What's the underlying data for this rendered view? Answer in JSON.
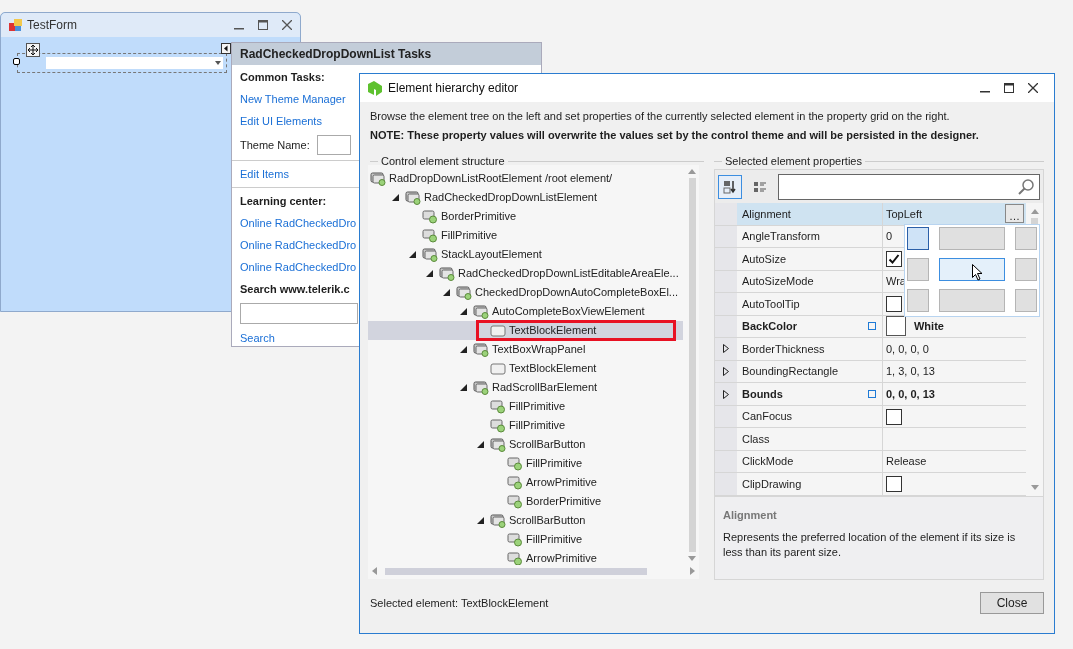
{
  "form": {
    "title": "TestForm"
  },
  "tasks": {
    "title": "RadCheckedDropDownList Tasks",
    "items": [
      {
        "kind": "heading",
        "text": "Common Tasks:"
      },
      {
        "kind": "link",
        "text": "New Theme Manager"
      },
      {
        "kind": "link",
        "text": "Edit UI Elements"
      },
      {
        "kind": "field",
        "text": "Theme Name:"
      },
      {
        "kind": "divider"
      },
      {
        "kind": "link",
        "text": "Edit Items"
      },
      {
        "kind": "divider"
      },
      {
        "kind": "heading",
        "text": "Learning center:"
      },
      {
        "kind": "link",
        "text": "Online RadCheckedDro"
      },
      {
        "kind": "link",
        "text": "Online RadCheckedDro"
      },
      {
        "kind": "link",
        "text": "Online RadCheckedDro"
      },
      {
        "kind": "heading",
        "text": "Search www.telerik.c"
      },
      {
        "kind": "input"
      },
      {
        "kind": "link",
        "text": "Search"
      }
    ]
  },
  "editor": {
    "title": "Element hierarchy editor",
    "description": "Browse the element tree on the left and set properties of the currently selected element in the property grid on the right.",
    "note": "NOTE: These property values will overwrite the values set by the control theme and will be persisted in the designer.",
    "tree": {
      "label": "Control element structure",
      "nodes": [
        {
          "text": "RadDropDownListRootElement /root element/",
          "kind": "element",
          "selected": false,
          "highlighted": false,
          "children": [
            {
              "text": "RadCheckedDropDownListElement",
              "kind": "element",
              "selected": false,
              "highlighted": false,
              "expanded": true,
              "children": [
                {
                  "text": "BorderPrimitive",
                  "kind": "primitive",
                  "selected": false,
                  "highlighted": false
                },
                {
                  "text": "FillPrimitive",
                  "kind": "primitive",
                  "selected": false,
                  "highlighted": false
                },
                {
                  "text": "StackLayoutElement",
                  "kind": "element",
                  "selected": false,
                  "highlighted": false,
                  "expanded": true,
                  "children": [
                    {
                      "text": "RadCheckedDropDownListEditableAreaEle...",
                      "kind": "element",
                      "selected": false,
                      "highlighted": false,
                      "expanded": true,
                      "children": [
                        {
                          "text": "CheckedDropDownAutoCompleteBoxEl...",
                          "kind": "element",
                          "selected": false,
                          "highlighted": false,
                          "expanded": true,
                          "children": [
                            {
                              "text": "AutoCompleteBoxViewElement",
                              "kind": "element",
                              "selected": false,
                              "highlighted": false,
                              "expanded": true,
                              "children": [
                                {
                                  "text": "TextBlockElement",
                                  "kind": "text",
                                  "selected": true,
                                  "highlighted": true
                                }
                              ]
                            },
                            {
                              "text": "TextBoxWrapPanel",
                              "kind": "element",
                              "selected": false,
                              "highlighted": false,
                              "expanded": true,
                              "children": [
                                {
                                  "text": "TextBlockElement",
                                  "kind": "text",
                                  "selected": false,
                                  "highlighted": false
                                }
                              ]
                            },
                            {
                              "text": "RadScrollBarElement",
                              "kind": "element",
                              "selected": false,
                              "highlighted": false,
                              "expanded": true,
                              "children": [
                                {
                                  "text": "FillPrimitive",
                                  "kind": "primitive",
                                  "selected": false,
                                  "highlighted": false
                                },
                                {
                                  "text": "FillPrimitive",
                                  "kind": "primitive",
                                  "selected": false,
                                  "highlighted": false
                                },
                                {
                                  "text": "ScrollBarButton",
                                  "kind": "element",
                                  "selected": false,
                                  "highlighted": false,
                                  "expanded": true,
                                  "children": [
                                    {
                                      "text": "FillPrimitive",
                                      "kind": "primitive",
                                      "selected": false,
                                      "highlighted": false
                                    },
                                    {
                                      "text": "ArrowPrimitive",
                                      "kind": "primitive",
                                      "selected": false,
                                      "highlighted": false
                                    },
                                    {
                                      "text": "BorderPrimitive",
                                      "kind": "primitive",
                                      "selected": false,
                                      "highlighted": false
                                    }
                                  ]
                                },
                                {
                                  "text": "ScrollBarButton",
                                  "kind": "element",
                                  "selected": false,
                                  "highlighted": false,
                                  "expanded": true,
                                  "children": [
                                    {
                                      "text": "FillPrimitive",
                                      "kind": "primitive",
                                      "selected": false,
                                      "highlighted": false
                                    },
                                    {
                                      "text": "ArrowPrimitive",
                                      "kind": "primitive",
                                      "selected": false,
                                      "highlighted": false
                                    }
                                  ]
                                }
                              ]
                            }
                          ]
                        }
                      ]
                    }
                  ]
                }
              ]
            }
          ]
        }
      ]
    },
    "properties": {
      "label": "Selected element properties",
      "toolbar": [
        {
          "kind": "alphabetical",
          "selected": true
        },
        {
          "kind": "categorized",
          "selected": false
        }
      ],
      "rows": [
        {
          "name": "Alignment",
          "kind": "text",
          "value": "TopLeft",
          "button": "…",
          "selected": true,
          "modified": false,
          "expandable": false
        },
        {
          "name": "AngleTransform",
          "kind": "text",
          "value": "0",
          "selected": false,
          "modified": false,
          "expandable": false
        },
        {
          "name": "AutoSize",
          "kind": "checkbox",
          "checked": true,
          "selected": false,
          "modified": false,
          "expandable": false
        },
        {
          "name": "AutoSizeMode",
          "kind": "text",
          "value": "Wra",
          "selected": false,
          "modified": false,
          "expandable": false
        },
        {
          "name": "AutoToolTip",
          "kind": "checkbox",
          "checked": false,
          "selected": false,
          "modified": false,
          "expandable": false
        },
        {
          "name": "BackColor",
          "kind": "color",
          "value": "White",
          "color": "#ffffff",
          "selected": false,
          "modified": true,
          "expandable": false
        },
        {
          "name": "BorderThickness",
          "kind": "text",
          "value": "0, 0, 0, 0",
          "selected": false,
          "modified": false,
          "expandable": true
        },
        {
          "name": "BoundingRectangle",
          "kind": "text",
          "value": "1, 3, 0, 13",
          "selected": false,
          "modified": false,
          "expandable": true
        },
        {
          "name": "Bounds",
          "kind": "text",
          "value": "0, 0, 0, 13",
          "selected": false,
          "modified": true,
          "expandable": true
        },
        {
          "name": "CanFocus",
          "kind": "checkbox",
          "checked": false,
          "selected": false,
          "modified": false,
          "expandable": false
        },
        {
          "name": "Class",
          "kind": "text",
          "selected": false,
          "modified": false,
          "expandable": false
        },
        {
          "name": "ClickMode",
          "kind": "text",
          "value": "Release",
          "selected": false,
          "modified": false,
          "expandable": false
        },
        {
          "name": "ClipDrawing",
          "kind": "checkbox",
          "checked": false,
          "selected": false,
          "modified": false,
          "expandable": false
        }
      ],
      "picker": {
        "cells": [
          {
            "selected": true,
            "hovered": false
          },
          {
            "selected": false,
            "hovered": false
          },
          {
            "selected": false,
            "hovered": false
          },
          {
            "selected": false,
            "hovered": false
          },
          {
            "selected": false,
            "hovered": true
          },
          {
            "selected": false,
            "hovered": false
          },
          {
            "selected": false,
            "hovered": false
          },
          {
            "selected": false,
            "hovered": false
          },
          {
            "selected": false,
            "hovered": false
          }
        ]
      },
      "help": {
        "title": "Alignment",
        "text": "Represents the preferred location of the element if its size is less than its parent size."
      }
    },
    "status": "Selected element: TextBlockElement",
    "close_button": "Close"
  }
}
